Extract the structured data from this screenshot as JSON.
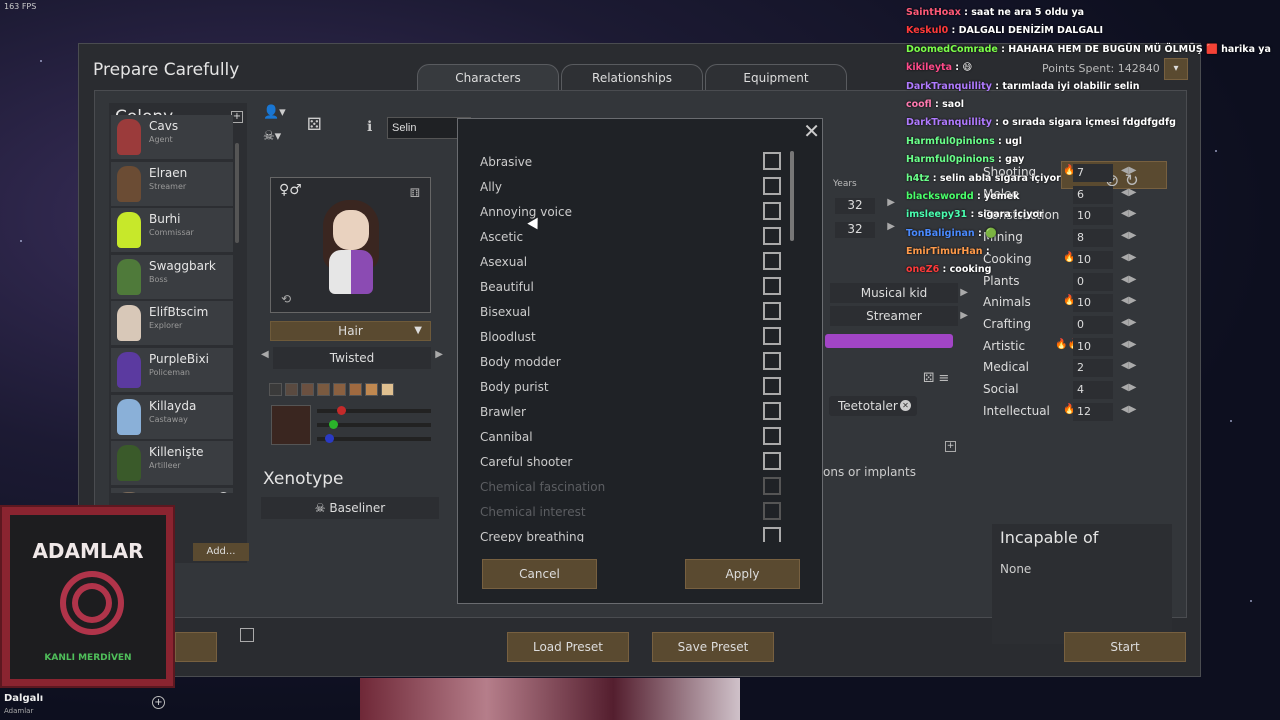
{
  "fps": "163 FPS",
  "window": {
    "title": "Prepare Carefully",
    "points_spent": "Points Spent: 142840",
    "tabs": [
      "Characters",
      "Relationships",
      "Equipment"
    ]
  },
  "colony": {
    "title": "Colony",
    "pawns": [
      {
        "name": "Cavs",
        "role": "Agent",
        "color": "#9b3b3b"
      },
      {
        "name": "Elraen",
        "role": "Streamer",
        "color": "#6b4c34"
      },
      {
        "name": "Burhi",
        "role": "Commissar",
        "color": "#c7e82a"
      },
      {
        "name": "Swaggbark",
        "role": "Boss",
        "color": "#4f7a3a"
      },
      {
        "name": "ElifBtscim",
        "role": "Explorer",
        "color": "#d8c8b8"
      },
      {
        "name": "PurpleBixi",
        "role": "Policeman",
        "color": "#5b3aa0"
      },
      {
        "name": "Killayda",
        "role": "Castaway",
        "color": "#8ab0d8"
      },
      {
        "name": "Killenişte",
        "role": "Artilleer",
        "color": "#3a5a2a"
      },
      {
        "name": "...enge",
        "role": "...ner",
        "color": "#7a6a5a"
      }
    ],
    "add_button": "Add..."
  },
  "pawn_editor": {
    "name_value": "Selin",
    "hair_label": "Hair",
    "hair_style": "Twisted",
    "swatch_colors": [
      "#3a3a3a",
      "#5a4a40",
      "#6b5040",
      "#7a5a40",
      "#8a6040",
      "#a06a40",
      "#c08850",
      "#e0c090"
    ],
    "xenotype_title": "Xenotype",
    "xenotype_value": "Baseliner"
  },
  "bio": {
    "years_label": "Years",
    "age_bio": "32",
    "age_chrono": "32",
    "childhood": "Musical kid",
    "adulthood": "Streamer",
    "trait": "Teetotaler",
    "implants_text": "ons or implants"
  },
  "skills": [
    {
      "name": "Shooting",
      "value": "7",
      "passion": "🔥"
    },
    {
      "name": "Melee",
      "value": "6",
      "passion": ""
    },
    {
      "name": "Construction",
      "value": "10",
      "passion": ""
    },
    {
      "name": "Mining",
      "value": "8",
      "passion": ""
    },
    {
      "name": "Cooking",
      "value": "10",
      "passion": "🔥"
    },
    {
      "name": "Plants",
      "value": "0",
      "passion": ""
    },
    {
      "name": "Animals",
      "value": "10",
      "passion": "🔥"
    },
    {
      "name": "Crafting",
      "value": "0",
      "passion": ""
    },
    {
      "name": "Artistic",
      "value": "10",
      "passion": "🔥🔥"
    },
    {
      "name": "Medical",
      "value": "2",
      "passion": ""
    },
    {
      "name": "Social",
      "value": "4",
      "passion": ""
    },
    {
      "name": "Intellectual",
      "value": "12",
      "passion": "🔥"
    }
  ],
  "incapable": {
    "title": "Incapable of",
    "value": "None"
  },
  "bottom_buttons": {
    "load": "Load Preset",
    "save": "Save Preset",
    "start": "Start"
  },
  "trait_dialog": {
    "traits": [
      {
        "label": "Abrasive",
        "disabled": false
      },
      {
        "label": "Ally",
        "disabled": false
      },
      {
        "label": "Annoying voice",
        "disabled": false
      },
      {
        "label": "Ascetic",
        "disabled": false
      },
      {
        "label": "Asexual",
        "disabled": false
      },
      {
        "label": "Beautiful",
        "disabled": false
      },
      {
        "label": "Bisexual",
        "disabled": false
      },
      {
        "label": "Bloodlust",
        "disabled": false
      },
      {
        "label": "Body modder",
        "disabled": false
      },
      {
        "label": "Body purist",
        "disabled": false
      },
      {
        "label": "Brawler",
        "disabled": false
      },
      {
        "label": "Cannibal",
        "disabled": false
      },
      {
        "label": "Careful shooter",
        "disabled": false
      },
      {
        "label": "Chemical fascination",
        "disabled": true
      },
      {
        "label": "Chemical interest",
        "disabled": true
      },
      {
        "label": "Creepy breathing",
        "disabled": false
      }
    ],
    "cancel": "Cancel",
    "apply": "Apply"
  },
  "chat": [
    {
      "user": "SaintHoax",
      "text": "saat ne ara 5 oldu ya",
      "color": "#ff5a78"
    },
    {
      "user": "Keskul0",
      "text": "DALGALI DENİZİM DALGALI",
      "color": "#ff3a3a"
    },
    {
      "user": "DoomedComrade",
      "text": "HAHAHA HEM DE BUGÜN MÜ ÖLMÜŞ 🟥 harika ya",
      "color": "#7cff4a"
    },
    {
      "user": "kikileyta",
      "text": "😄",
      "color": "#ff4a8a"
    },
    {
      "user": "DarkTranquillity",
      "text": "tarımlada iyi olabilir selin",
      "color": "#b07aff"
    },
    {
      "user": "coofl",
      "text": "saol",
      "color": "#ff7ab0"
    },
    {
      "user": "DarkTranquillity",
      "text": "o sırada sigara içmesi fdgdfgdfg",
      "color": "#b07aff"
    },
    {
      "user": "Harmful0pinions",
      "text": "ugl",
      "color": "#6aff8a"
    },
    {
      "user": "Harmful0pinions",
      "text": "gay",
      "color": "#6aff8a"
    },
    {
      "user": "h4tz",
      "text": "selin abla sigara içiyor",
      "color": "#6aff8a"
    },
    {
      "user": "blackswordd",
      "text": "yemek",
      "color": "#4aff6a"
    },
    {
      "user": "imsleepy31",
      "text": "sigara içiyor",
      "color": "#4affb0"
    },
    {
      "user": "TonBaliginan",
      "text": "🟢",
      "color": "#4a8aff"
    },
    {
      "user": "EmirTimurHan",
      "text": "",
      "color": "#ff9a4a"
    },
    {
      "user": "oneZ6",
      "text": "cooking",
      "color": "#ff3a3a"
    }
  ],
  "media": {
    "album_title": "ADAMLAR",
    "album_sub": "KANLI MERDİVEN",
    "artist": "Dalgalı",
    "artist_sub": "Adamlar"
  }
}
